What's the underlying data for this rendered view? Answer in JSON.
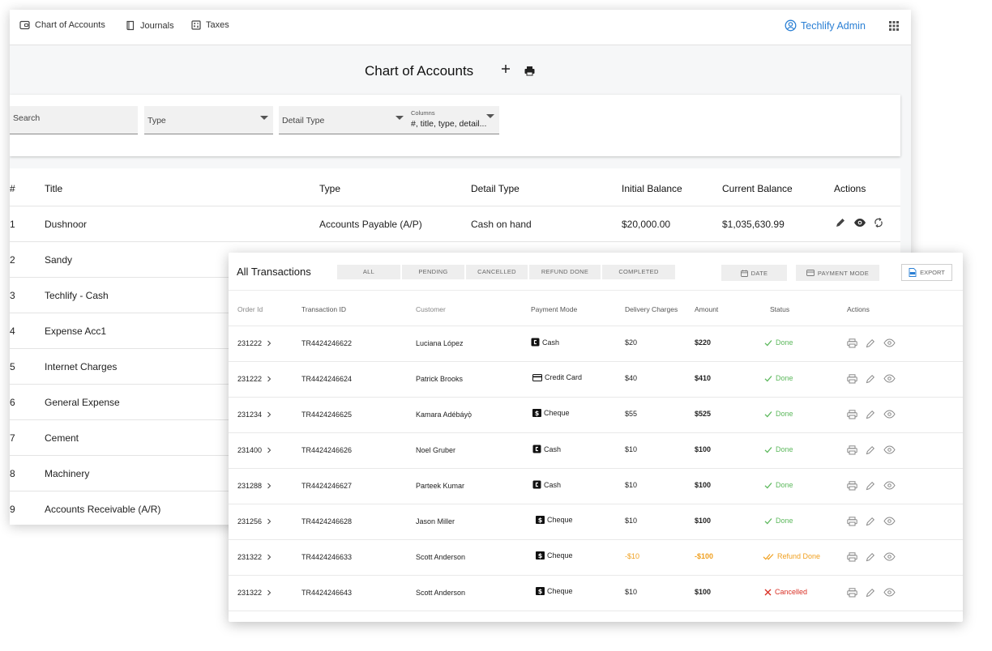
{
  "nav": {
    "items": [
      {
        "label": "Chart of Accounts",
        "icon": "wallet-icon"
      },
      {
        "label": "Journals",
        "icon": "book-icon"
      },
      {
        "label": "Taxes",
        "icon": "calculator-icon"
      }
    ],
    "user_label": "Techlify Admin",
    "user_icon": "user-circle-icon",
    "apps_icon": "apps-grid-icon"
  },
  "accounts": {
    "title": "Chart of Accounts",
    "add_icon": "plus-icon",
    "print_icon": "print-icon",
    "filters": {
      "search_placeholder": "Search",
      "type_placeholder": "Type",
      "detail_type_placeholder": "Detail Type",
      "columns_label": "Columns",
      "columns_value": "#, title, type, detail..."
    },
    "columns": [
      "#",
      "Title",
      "Type",
      "Detail Type",
      "Initial Balance",
      "Current Balance",
      "Actions"
    ],
    "rows": [
      {
        "num": "1",
        "title": "Dushnoor",
        "type": "Accounts Payable (A/P)",
        "detail_type": "Cash on hand",
        "initial": "$20,000.00",
        "current": "$1,035,630.99"
      },
      {
        "num": "2",
        "title": "Sandy"
      },
      {
        "num": "3",
        "title": "Techlify - Cash"
      },
      {
        "num": "4",
        "title": "Expense Acc1"
      },
      {
        "num": "5",
        "title": "Internet Charges"
      },
      {
        "num": "6",
        "title": "General Expense"
      },
      {
        "num": "7",
        "title": "Cement"
      },
      {
        "num": "8",
        "title": "Machinery"
      },
      {
        "num": "9",
        "title": "Accounts Receivable (A/R)"
      }
    ]
  },
  "transactions": {
    "title": "All Transactions",
    "tabs": [
      "ALL",
      "PENDING",
      "CANCELLED",
      "REFUND DONE",
      "COMPLETED"
    ],
    "date_button": "DATE",
    "payment_mode_button": "PAYMENT MODE",
    "export_button": "EXPORT",
    "columns": [
      "Order Id",
      "Transaction ID",
      "Customer",
      "Payment Mode",
      "Delivery Charges",
      "Amount",
      "Status",
      "Actions"
    ],
    "rows": [
      {
        "order_id": "231222",
        "transaction_id": "TR4424246622",
        "customer": "Luciana López",
        "payment_mode": "Cash",
        "delivery": "$20",
        "amount": "$220",
        "status": "Done"
      },
      {
        "order_id": "231222",
        "transaction_id": "TR4424246624",
        "customer": "Patrick Brooks",
        "payment_mode": "Credit Card",
        "delivery": "$40",
        "amount": "$410",
        "status": "Done"
      },
      {
        "order_id": "231234",
        "transaction_id": "TR4424246625",
        "customer": "Kamara Adébáyọ̀",
        "payment_mode": "Cheque",
        "delivery": "$55",
        "amount": "$525",
        "status": "Done"
      },
      {
        "order_id": "231400",
        "transaction_id": "TR4424246626",
        "customer": "Noel Gruber",
        "payment_mode": "Cash",
        "delivery": "$10",
        "amount": "$100",
        "status": "Done"
      },
      {
        "order_id": "231288",
        "transaction_id": "TR4424246627",
        "customer": "Parteek Kumar",
        "payment_mode": "Cash",
        "delivery": "$10",
        "amount": "$100",
        "status": "Done"
      },
      {
        "order_id": "231256",
        "transaction_id": "TR4424246628",
        "customer": "Jason Miller",
        "payment_mode": "Cheque",
        "delivery": "$10",
        "amount": "$100",
        "status": "Done"
      },
      {
        "order_id": "231322",
        "transaction_id": "TR4424246633",
        "customer": "Scott Anderson",
        "payment_mode": "Cheque",
        "delivery": "-$10",
        "amount": "-$100",
        "status": "Refund Done"
      },
      {
        "order_id": "231322",
        "transaction_id": "TR4424246643",
        "customer": "Scott Anderson",
        "payment_mode": "Cheque",
        "delivery": "$10",
        "amount": "$100",
        "status": "Cancelled"
      }
    ],
    "colors": {
      "done": "#5cb85c",
      "refund": "#f0a020",
      "cancelled": "#d93025",
      "accent": "#2a7fd4"
    }
  }
}
